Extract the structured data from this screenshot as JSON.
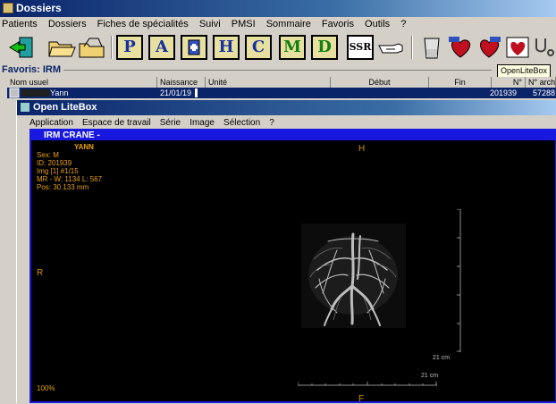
{
  "window": {
    "title": "Dossiers"
  },
  "menu": [
    "Patients",
    "Dossiers",
    "Fiches de spécialités",
    "Suivi",
    "PMSI",
    "Sommaire",
    "Favoris",
    "Outils",
    "?"
  ],
  "toolbar": {
    "letters": [
      "P",
      "A",
      "H",
      "C",
      "M",
      "D"
    ],
    "ssr_label": "SSR",
    "tooltip": "OpenLiteBox"
  },
  "favoris": {
    "label": "Favoris: IRM",
    "columns": [
      "Nom usuel",
      "Naissance",
      "Unité",
      "Début",
      "Fin",
      "N°",
      "N° archives"
    ],
    "row": {
      "nom": "Yann",
      "naissance": "21/01/19",
      "num": "201939",
      "archive": "57288"
    }
  },
  "child": {
    "title": "Open LiteBox",
    "menu": [
      "Application",
      "Espace de travail",
      "Série",
      "Image",
      "Sélection",
      "?"
    ]
  },
  "viewer": {
    "series_title": "IRM CRANE  -",
    "patient": "YANN",
    "info": [
      "Sex: M",
      "ID: 201939",
      "Img [1]  #1/15",
      "MR - W: 1134 L: 567",
      "Pos: 30.133 mm"
    ],
    "orient_top": "H",
    "orient_left": "R",
    "orient_bottom": "F",
    "scale_v": "21 cm",
    "scale_h": "21 cm",
    "zoom": "100%"
  }
}
